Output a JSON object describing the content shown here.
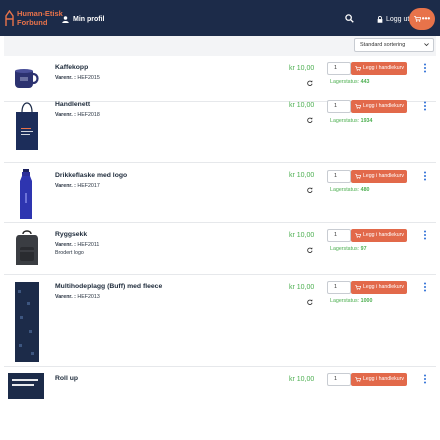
{
  "header": {
    "logo_line1": "Human-Etisk",
    "logo_line2": "Forbund",
    "profile_label": "Min profil",
    "logout_label": "Logg ut",
    "cart_dots": "•••",
    "icons": [
      "logo-icon",
      "user-icon",
      "search-icon",
      "lock-icon",
      "cart-icon"
    ],
    "colors": {
      "bar": "#1c2b49",
      "accent": "#e8734a"
    }
  },
  "toolbar": {
    "sort_selected": "Standard sortering"
  },
  "labels": {
    "sku_prefix": "Varenr. :",
    "stock_prefix": "Lagerstatus:",
    "add_button": "Legg i handlekurv"
  },
  "products": [
    {
      "name": "Kaffekopp",
      "sku": "HEF2015",
      "extra": "",
      "price": "kr 10,00",
      "qty": "1",
      "stock": "443"
    },
    {
      "name": "Handlenett",
      "sku": "HEF2018",
      "extra": "",
      "price": "kr 10,00",
      "qty": "1",
      "stock": "1934"
    },
    {
      "name": "Drikkeflaske med logo",
      "sku": "HEF2017",
      "extra": "",
      "price": "kr 10,00",
      "qty": "1",
      "stock": "480"
    },
    {
      "name": "Ryggsekk",
      "sku": "HEF2011",
      "extra": "Brodert logo",
      "price": "kr 10,00",
      "qty": "1",
      "stock": "97"
    },
    {
      "name": "Multihodeplagg (Buff) med fleece",
      "sku": "HEF2013",
      "extra": "",
      "price": "kr 10,00",
      "qty": "1",
      "stock": "1000"
    },
    {
      "name": "Roll up",
      "sku": "",
      "extra": "",
      "price": "kr 10,00",
      "qty": "1",
      "stock": ""
    }
  ],
  "colors": {
    "price": "#4caf50",
    "button": "#e2694a",
    "kebab": "#2f6fd6"
  }
}
